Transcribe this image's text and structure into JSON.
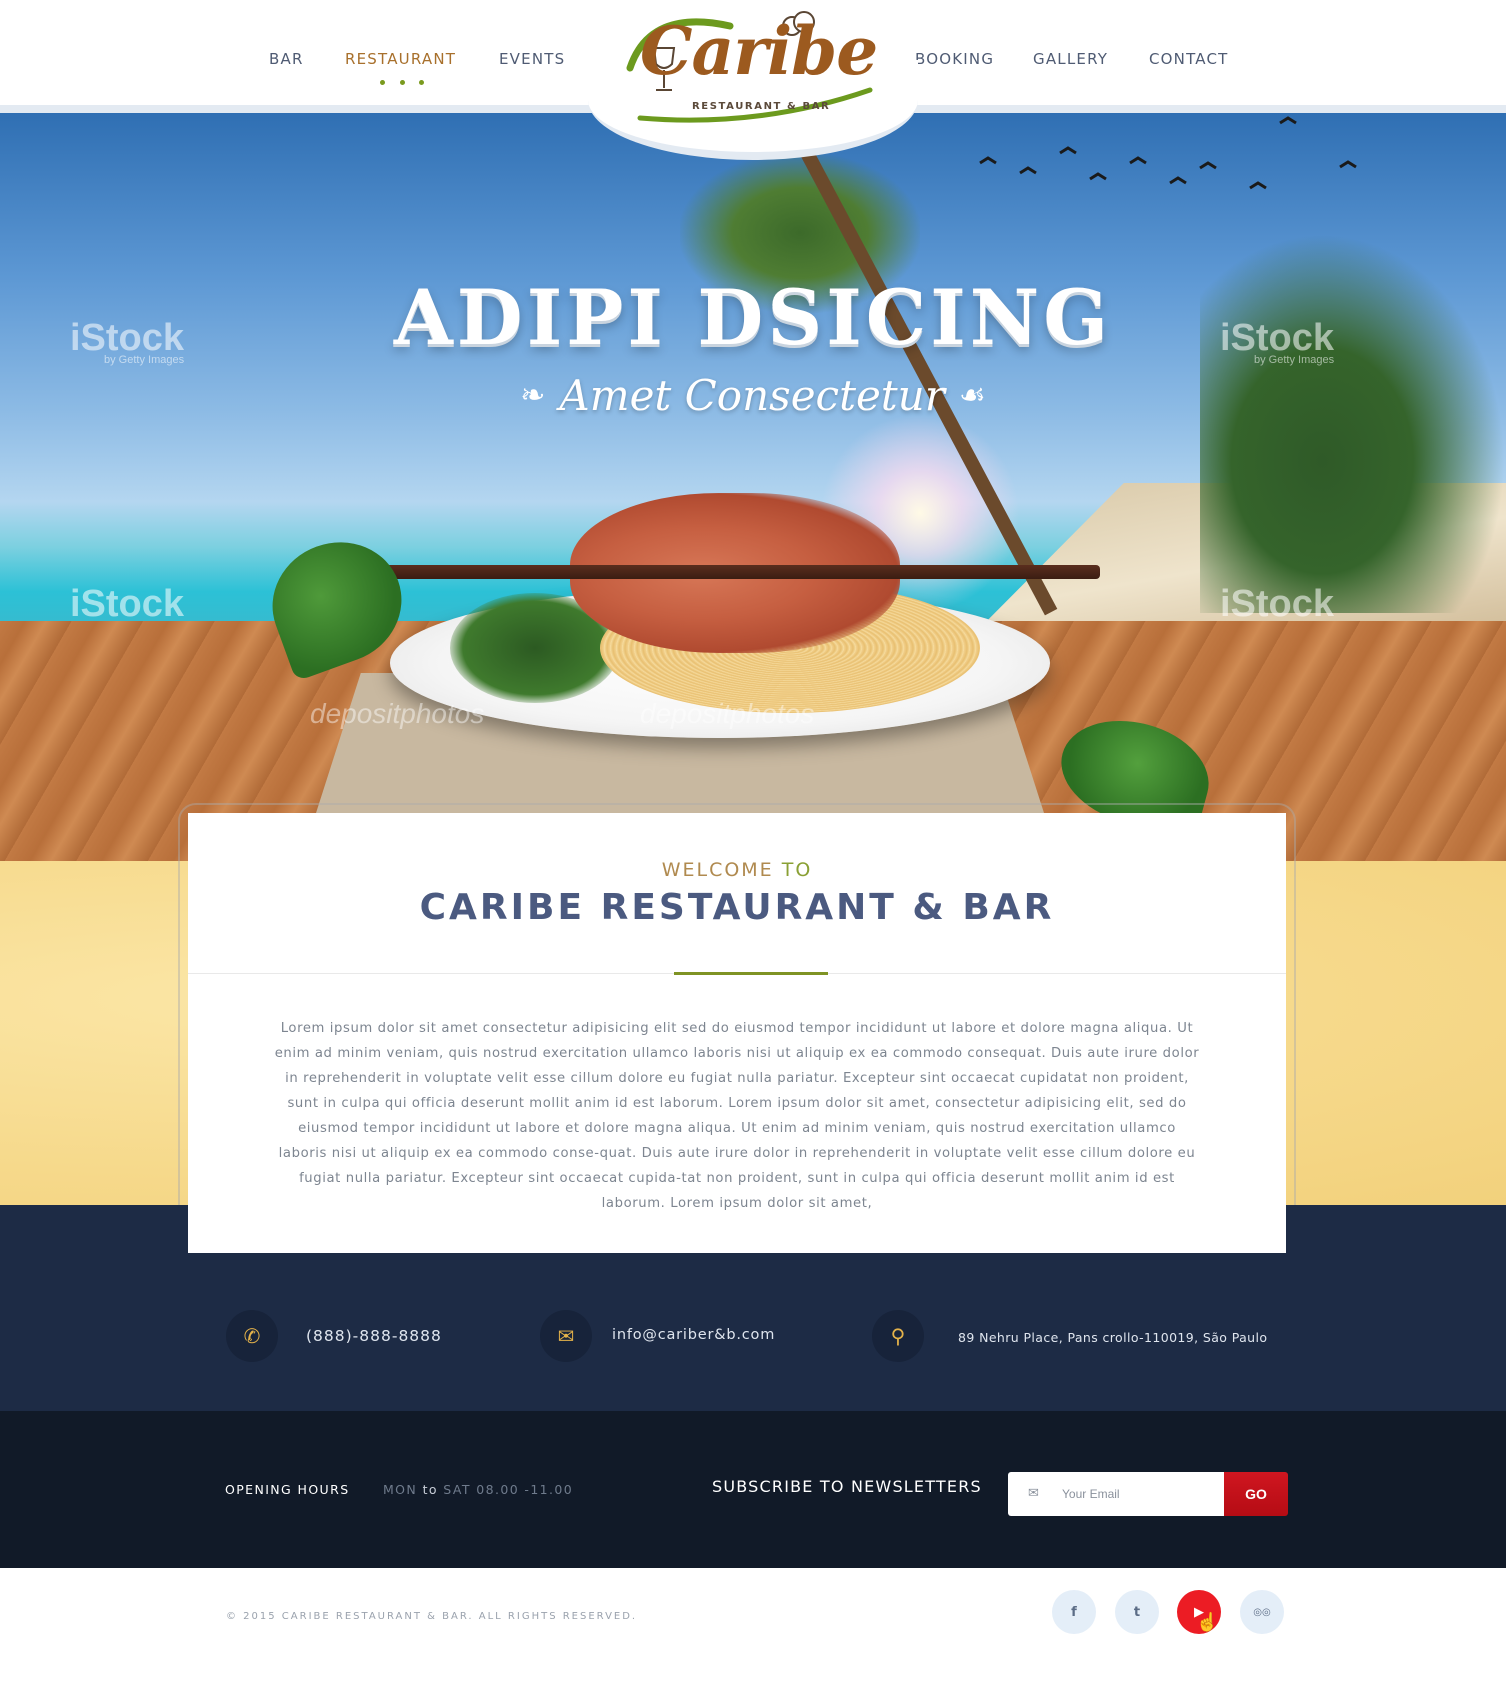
{
  "nav": {
    "left": [
      "BAR",
      "RESTAURANT",
      "EVENTS"
    ],
    "right": [
      "BOOKING",
      "GALLERY",
      "CONTACT"
    ],
    "active": "RESTAURANT"
  },
  "logo": {
    "word": "Caribe",
    "sub": "RESTAURANT & BAR"
  },
  "hero": {
    "title": "ADIPI DSICING",
    "subtitle": "Amet Consectetur",
    "watermarks": [
      "iStock",
      "by Getty Images",
      "depositphotos"
    ]
  },
  "welcome": {
    "pre": "WELCOME",
    "to": "TO",
    "title": "CARIBE RESTAURANT & BAR",
    "body": "Lorem ipsum dolor sit amet consectetur adipisicing elit sed do eiusmod tempor incididunt ut labore et dolore magna aliqua. Ut enim ad minim veniam, quis nostrud exercitation ullamco laboris nisi ut aliquip ex ea commodo consequat. Duis aute irure dolor in reprehenderit in voluptate velit esse cillum dolore eu fugiat nulla pariatur. Excepteur sint occaecat cupidatat non proident, sunt in culpa qui officia deserunt mollit anim id est laborum. Lorem ipsum dolor sit amet, consectetur adipisicing elit, sed do eiusmod tempor incididunt ut labore et dolore magna aliqua. Ut enim ad minim veniam, quis nostrud exercitation ullamco laboris nisi ut aliquip ex ea commodo conse-quat. Duis aute irure dolor in reprehenderit in voluptate velit esse cillum dolore eu fugiat nulla pariatur. Excepteur sint occaecat cupida-tat non proident, sunt in culpa qui officia deserunt mollit anim id est laborum. Lorem ipsum dolor sit amet,"
  },
  "contact": {
    "phone": "(888)-888-8888",
    "email": "info@cariber&b.com",
    "address": "89 Nehru Place, Pans crollo-110019, São Paulo",
    "icons": [
      "phone-icon",
      "envelope-icon",
      "map-pin-icon"
    ]
  },
  "hours": {
    "label": "OPENING HOURS",
    "days_from": "MON",
    "to": "to",
    "days_to": "SAT",
    "time": "08.00 -11.00"
  },
  "newsletter": {
    "label": "SUBSCRIBE TO NEWSLETTERS",
    "placeholder": "Your Email",
    "button": "GO"
  },
  "footer": {
    "copyright": "© 2015 CARIBE RESTAURANT & BAR. ALL RIGHTS RESERVED.",
    "social": [
      {
        "name": "facebook",
        "glyph": "f"
      },
      {
        "name": "twitter",
        "glyph": "t"
      },
      {
        "name": "youtube",
        "glyph": "▶"
      },
      {
        "name": "tripadvisor",
        "glyph": "◎◎"
      }
    ],
    "active_social": "youtube"
  },
  "colors": {
    "accent": "#a8702c",
    "green": "#7f9324",
    "navy": "#1d2b45",
    "dark": "#111a28",
    "red": "#ec1c24"
  }
}
